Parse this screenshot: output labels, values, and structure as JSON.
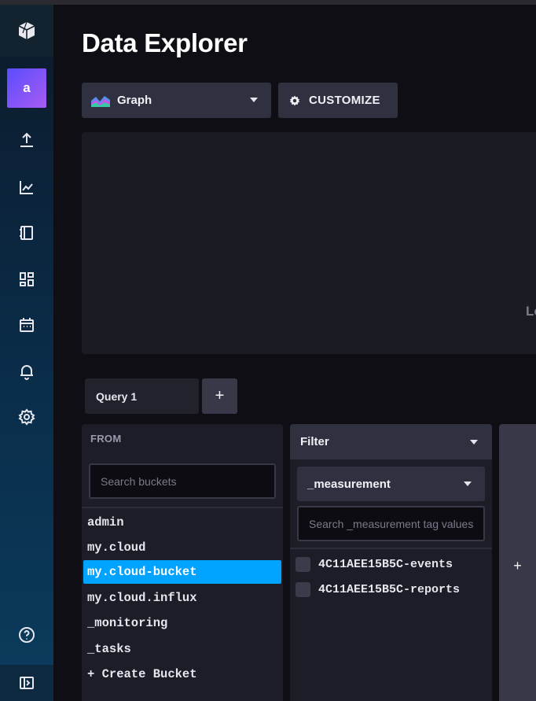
{
  "app": {
    "title": "Data Explorer"
  },
  "sidebar": {
    "avatar_letter": "a",
    "items": [
      {
        "icon": "upload-icon"
      },
      {
        "icon": "chart-line-icon"
      },
      {
        "icon": "notebook-icon"
      },
      {
        "icon": "dashboards-icon"
      },
      {
        "icon": "calendar-icon"
      },
      {
        "icon": "bell-icon"
      },
      {
        "icon": "gear-icon"
      }
    ],
    "help_icon": "help-icon",
    "collapse_icon": "sidebar-toggle-icon"
  },
  "toolbar": {
    "graph_type_label": "Graph",
    "customize_label": "CUSTOMIZE"
  },
  "graph": {
    "edge_text": "Lo"
  },
  "queries": {
    "tabs": [
      {
        "label": "Query 1"
      }
    ],
    "add_label": "+"
  },
  "from": {
    "label": "FROM",
    "search_placeholder": "Search buckets",
    "buckets": [
      "admin",
      "my.cloud",
      "my.cloud-bucket",
      "my.cloud.influx",
      "_monitoring",
      "_tasks"
    ],
    "selected_bucket": "my.cloud-bucket",
    "create_label": "+ Create Bucket"
  },
  "filter": {
    "header_label": "Filter",
    "key_selected": "_measurement",
    "tag_search_placeholder": "Search _measurement tag values",
    "values": [
      "4C11AEE15B5C-events",
      "4C11AEE15B5C-reports"
    ],
    "add_label": "+"
  },
  "colors": {
    "accent": "#00a3ff",
    "background": "#0e0e14",
    "panel": "#1d1d28",
    "avatar_gradient_start": "#5a4dfc",
    "avatar_gradient_end": "#a85cf5"
  }
}
